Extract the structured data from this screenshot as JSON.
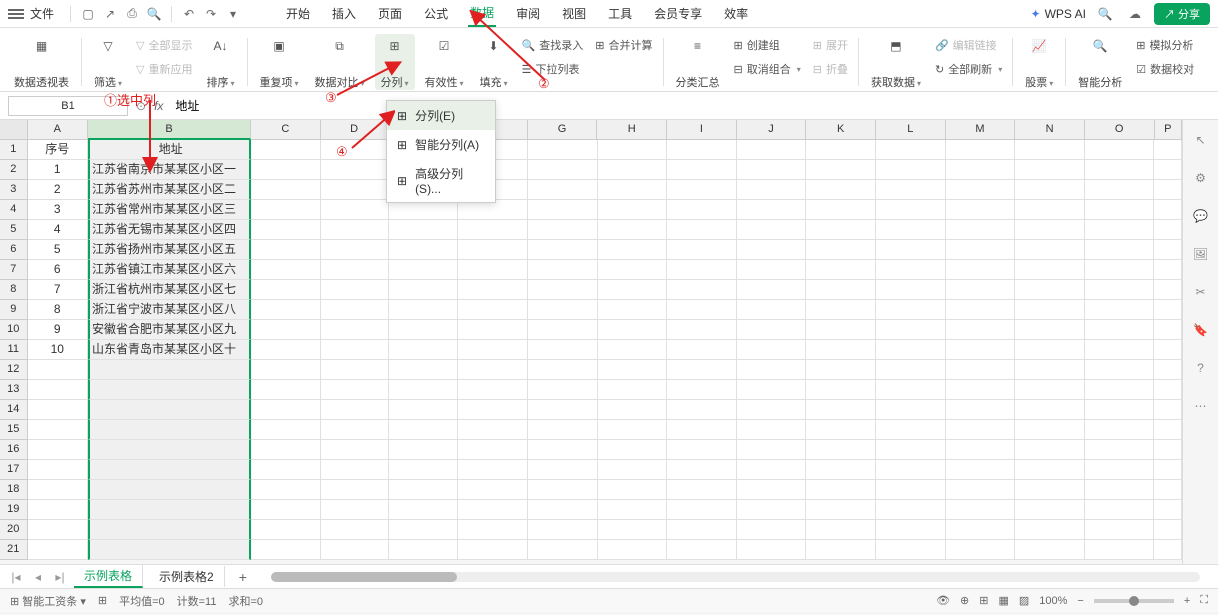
{
  "titlebar": {
    "file": "文件",
    "tabs": [
      "开始",
      "插入",
      "页面",
      "公式",
      "数据",
      "审阅",
      "视图",
      "工具",
      "会员专享",
      "效率"
    ],
    "active_tab_index": 4,
    "wps_ai": "WPS AI",
    "share": "分享"
  },
  "ribbon": {
    "pivot": "数据透视表",
    "filter": "筛选",
    "show_all": "全部显示",
    "reapply": "重新应用",
    "sort": "排序",
    "duplicates": "重复项",
    "data_compare": "数据对比",
    "split": "分列",
    "validity": "有效性",
    "fill": "填充",
    "find_input": "查找录入",
    "consolidate": "合并计算",
    "dropdown_list": "下拉列表",
    "subtotal": "分类汇总",
    "create_group": "创建组",
    "ungroup": "取消组合",
    "expand": "展开",
    "collapse": "折叠",
    "get_data": "获取数据",
    "edit_link": "编辑链接",
    "refresh_all": "全部刷新",
    "stocks": "股票",
    "analysis": "智能分析",
    "whatif": "模拟分析",
    "data_validation": "数据校对"
  },
  "dropdown": {
    "item1": "分列(E)",
    "item2": "智能分列(A)",
    "item3": "高级分列(S)..."
  },
  "annotations": {
    "a1": "①选中列",
    "a2": "②",
    "a3": "③",
    "a4": "④"
  },
  "name_box": "B1",
  "formula_value": "地址",
  "grid": {
    "col_widths": {
      "A": 66,
      "B": 178,
      "C": 76,
      "D": 74,
      "E": 76,
      "F": 76,
      "G": 76,
      "H": 76,
      "I": 76,
      "J": 76,
      "K": 76,
      "L": 76,
      "M": 76,
      "N": 76,
      "O": 76,
      "P": 30
    },
    "columns": [
      "A",
      "B",
      "C",
      "D",
      "E",
      "F",
      "G",
      "H",
      "I",
      "J",
      "K",
      "L",
      "M",
      "N",
      "O",
      "P"
    ],
    "headers": {
      "A": "序号",
      "B": "地址"
    },
    "rows": [
      {
        "num": 1,
        "A": "1",
        "B": "江苏省南京市某某区小区一"
      },
      {
        "num": 2,
        "A": "2",
        "B": "江苏省苏州市某某区小区二"
      },
      {
        "num": 3,
        "A": "3",
        "B": "江苏省常州市某某区小区三"
      },
      {
        "num": 4,
        "A": "4",
        "B": "江苏省无锡市某某区小区四"
      },
      {
        "num": 5,
        "A": "5",
        "B": "江苏省扬州市某某区小区五"
      },
      {
        "num": 6,
        "A": "6",
        "B": "江苏省镇江市某某区小区六"
      },
      {
        "num": 7,
        "A": "7",
        "B": "浙江省杭州市某某区小区七"
      },
      {
        "num": 8,
        "A": "8",
        "B": "浙江省宁波市某某区小区八"
      },
      {
        "num": 9,
        "A": "9",
        "B": "安徽省合肥市某某区小区九"
      },
      {
        "num": 10,
        "A": "10",
        "B": "山东省青岛市某某区小区十"
      }
    ],
    "total_rows": 21
  },
  "sheets": {
    "tabs": [
      "示例表格",
      "示例表格2"
    ],
    "active": 0
  },
  "status": {
    "tool": "智能工资条",
    "avg": "平均值=0",
    "count": "计数=11",
    "sum": "求和=0",
    "zoom": "100%"
  }
}
